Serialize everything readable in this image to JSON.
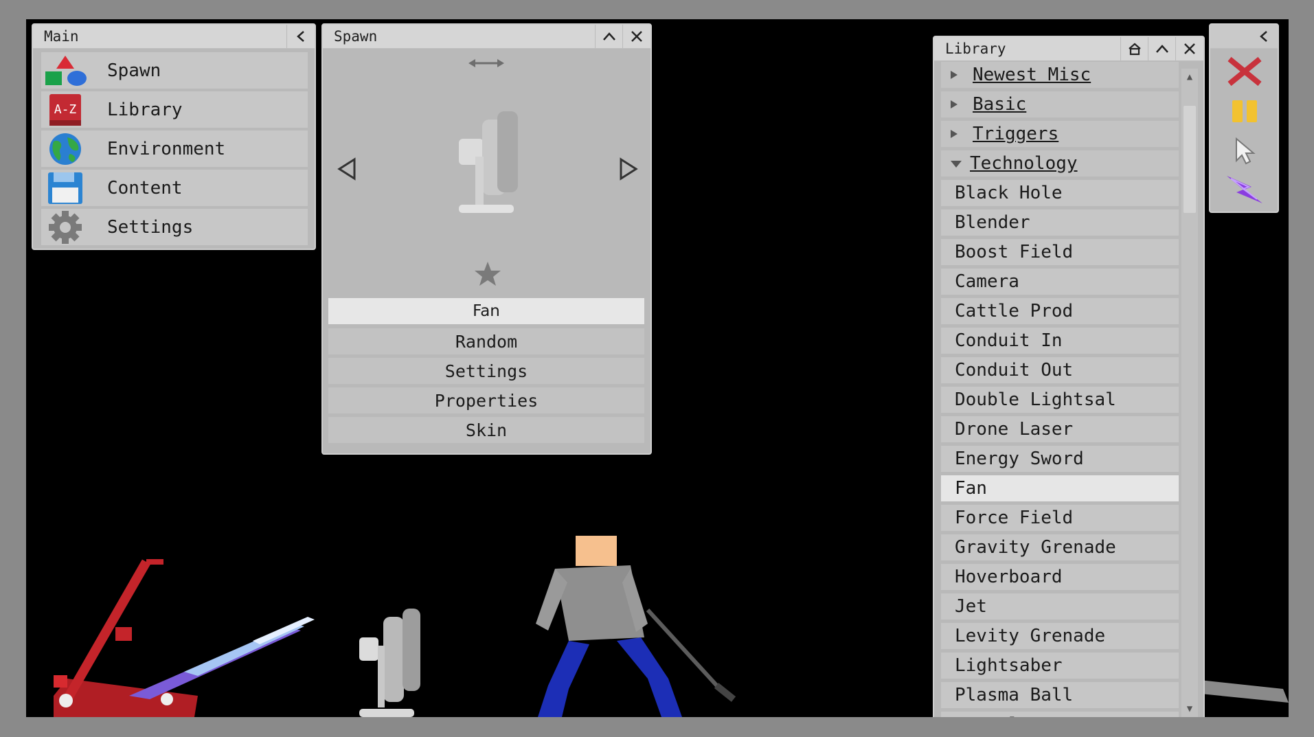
{
  "main_panel": {
    "title": "Main",
    "items": [
      {
        "label": "Spawn",
        "icon": "shapes-icon"
      },
      {
        "label": "Library",
        "icon": "book-az-icon"
      },
      {
        "label": "Environment",
        "icon": "globe-icon"
      },
      {
        "label": "Content",
        "icon": "floppy-disk-icon"
      },
      {
        "label": "Settings",
        "icon": "gear-icon"
      }
    ]
  },
  "spawn_panel": {
    "title": "Spawn",
    "selected_item": "Fan",
    "buttons": [
      "Random",
      "Settings",
      "Properties",
      "Skin"
    ]
  },
  "library_panel": {
    "title": "Library",
    "categories": [
      "Newest Misc",
      "Basic",
      "Triggers",
      "Technology"
    ],
    "items": [
      "Black Hole",
      "Blender",
      "Boost Field",
      "Camera",
      "Cattle Prod",
      "Conduit In",
      "Conduit Out",
      "Double Lightsal",
      "Drone Laser",
      "Energy Sword",
      "Fan",
      "Force Field",
      "Gravity Grenade",
      "Hoverboard",
      "Jet",
      "Levity Grenade",
      "Lightsaber",
      "Plasma Ball",
      "Portal"
    ],
    "selected": "Fan"
  },
  "tools_panel": {
    "tools": [
      "close-x-icon",
      "pause-icon",
      "cursor-icon",
      "lightning-icon"
    ]
  },
  "colors": {
    "panel_bg": "#b9b9b9",
    "header_bg": "#d6d6d6",
    "selected_bg": "#e6e6e6",
    "game_bg": "#000000",
    "close_red": "#c8323c",
    "pause_yellow": "#f2c230",
    "lightning_purple": "#8a3de0"
  }
}
